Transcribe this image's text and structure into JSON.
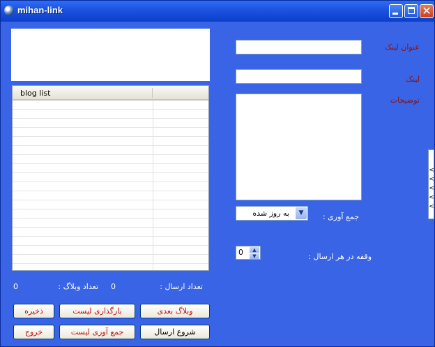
{
  "window": {
    "title": "mihan-link"
  },
  "list": {
    "column_header": "blog list"
  },
  "form": {
    "link_title_label": "عنوان لینک",
    "link_label": "لینک",
    "description_label": "توضیحات",
    "collect_label": "جمع آوری  :",
    "collect_selected": "به روز شده",
    "delay_label": "وقفه در هر ارسال  :",
    "delay_value": "0"
  },
  "stats": {
    "sent_label": "تعداد ارسال   :",
    "sent_value": "0",
    "blog_count_label": "تعداد وبلاگ   :",
    "blog_count_value": "0"
  },
  "buttons": {
    "next_blog": "وبلاگ بعدی",
    "load_list": "بارگذاری لیست",
    "save": "ذخیره",
    "start_send": "شروع ارسال",
    "collect_list": "جمع آوری لیست",
    "exit": "خروج"
  },
  "side_tab": {
    "glyphs": [
      "<",
      "<",
      "<",
      "<",
      "<"
    ]
  }
}
